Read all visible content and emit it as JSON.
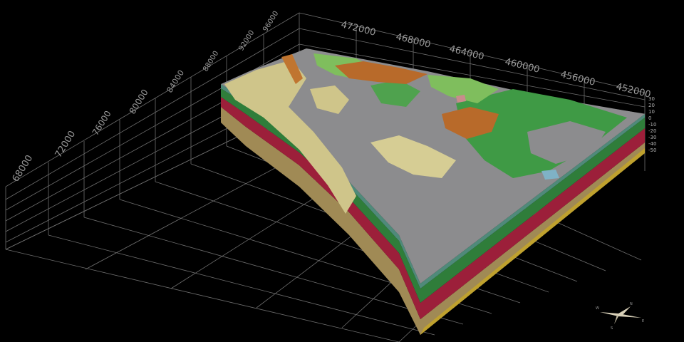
{
  "x_axis": {
    "ticks": [
      "472000",
      "468000",
      "464000",
      "460000",
      "456000",
      "452000"
    ]
  },
  "y_axis": {
    "ticks": [
      "96000",
      "92000",
      "88000",
      "84000",
      "80000",
      "76000",
      "72000",
      "68000"
    ]
  },
  "z_axis": {
    "ticks": [
      "30",
      "20",
      "10",
      "0",
      "-10",
      "-20",
      "-30",
      "-40",
      "-50"
    ]
  },
  "compass": {
    "north": "N",
    "east": "E",
    "south": "S",
    "west": "W"
  },
  "colors": {
    "background": "#000000",
    "grid": "#6e6e6e",
    "gray": "#8c8c8e",
    "khaki": "#cfc58a",
    "green": "#3f9a45",
    "light_green": "#7fbe5d",
    "orange": "#b86a2a",
    "red": "#9c1f3a",
    "yellow": "#bfa12e",
    "teal": "#4f8a7a"
  }
}
